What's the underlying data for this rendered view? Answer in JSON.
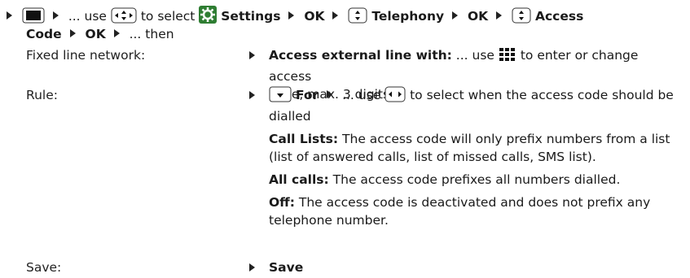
{
  "intro": {
    "use_text": "use",
    "to_select": "to select",
    "settings_label": "Settings",
    "ok": "OK",
    "telephony_label": "Telephony",
    "access_code_label_1": "Access",
    "access_code_label_2": "Code",
    "then": "then",
    "ellipsis": "..."
  },
  "rows": {
    "fixed": {
      "label": "Fixed line network:",
      "bold": "Access external line with:",
      "use_text": "use",
      "line1_rest": "to enter or change access",
      "line2": "code, max. 3 digits"
    },
    "rule": {
      "label": "Rule:",
      "bold": "For",
      "use_text": "use",
      "line1_rest": "to select when the access code should be",
      "line2": "dialled",
      "options": [
        {
          "name": "Call Lists:",
          "desc": "The access code will only prefix numbers from a list (list of answered calls, list of missed calls, SMS list)."
        },
        {
          "name": "All calls:",
          "desc": "The access code prefixes all numbers dialled."
        },
        {
          "name": "Off:",
          "desc": "The access code is deactivated and does not prefix any telephone number."
        }
      ]
    },
    "save": {
      "label": "Save:",
      "value": "Save"
    }
  },
  "colors": {
    "settings_icon_bg": "#2e7d32",
    "key_border": "#333333"
  }
}
